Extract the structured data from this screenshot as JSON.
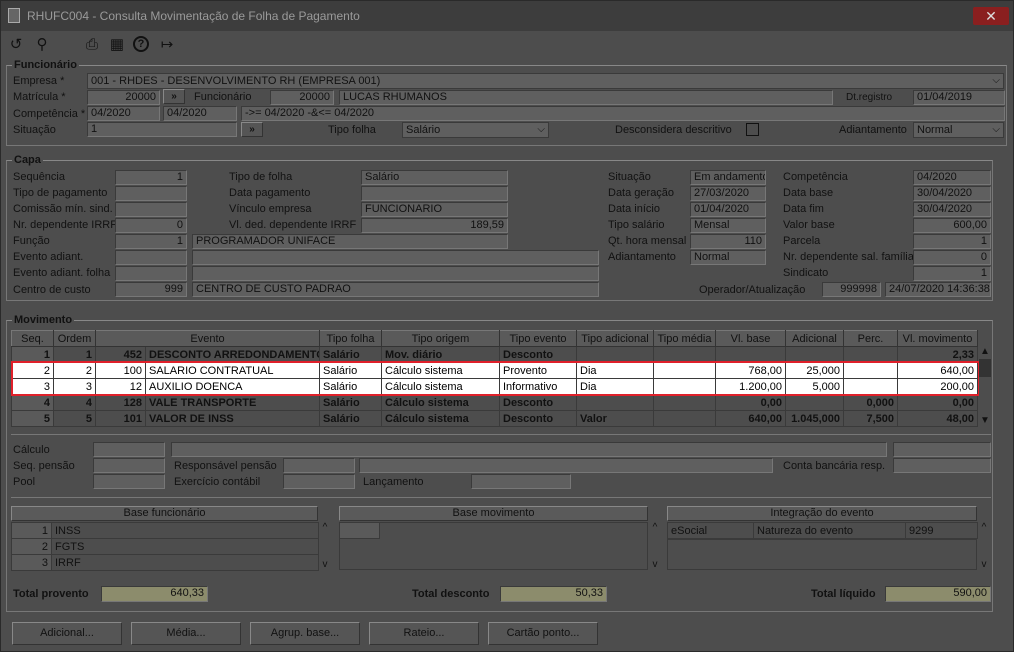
{
  "window": {
    "title": "RHUFC004 - Consulta Movimentação de Folha de Pagamento",
    "close": "✕"
  },
  "toolbar": {
    "icons": [
      "refresh-icon",
      "search-icon",
      "print-icon",
      "calendar-icon",
      "help-icon",
      "exit-icon"
    ],
    "glyphs": [
      "↺",
      "⚲",
      "⎙",
      "▦",
      "?",
      "↦"
    ]
  },
  "funcionario": {
    "title": "Funcionário",
    "empresa_label": "Empresa *",
    "empresa_value": "001 - RHDES - DESENVOLVIMENTO RH (EMPRESA 001)",
    "matricula_label": "Matrícula *",
    "matricula_value": "20000",
    "matricula_btn": "»",
    "funcionario_label": "Funcionário",
    "funcionario_code": "20000",
    "funcionario_name": "LUCAS RHUMANOS",
    "dtregistro_label": "Dt.registro",
    "dtregistro_value": "01/04/2019",
    "competencia_label": "Competência *",
    "competencia_de": "04/2020",
    "competencia_ate": "04/2020",
    "competencia_expr": "->= 04/2020 -&<= 04/2020",
    "situacao_label": "Situação",
    "situacao_value": "1",
    "situacao_btn": "»",
    "tipofolha_label": "Tipo folha",
    "tipofolha_value": "Salário",
    "descdesc_label": "Desconsidera descritivo",
    "adiantamento_label": "Adiantamento",
    "adiantamento_value": "Normal"
  },
  "capa": {
    "title": "Capa",
    "sequencia_label": "Sequência",
    "sequencia_value": "1",
    "tipopag_label": "Tipo de pagamento",
    "tipopag_value": "",
    "comissao_label": "Comissão mín. sind.",
    "comissao_value": "",
    "nrdep_label": "Nr. dependente IRRF",
    "nrdep_value": "0",
    "funcao_label": "Função",
    "funcao_code": "1",
    "funcao_name": "PROGRAMADOR UNIFACE",
    "evadiant_label": "Evento adiant.",
    "evadiant_value": "",
    "evadiantfolha_label": "Evento adiant. folha",
    "evadiantfolha_value": "",
    "ccusto_label": "Centro de custo",
    "ccusto_code": "999",
    "ccusto_name": "CENTRO DE CUSTO PADRAO",
    "tipofolha_label": "Tipo de folha",
    "tipofolha_value": "Salário",
    "datapag_label": "Data pagamento",
    "datapag_value": "",
    "vinculo_label": "Vínculo empresa",
    "vinculo_value": "FUNCIONARIO",
    "vlded_label": "Vl. ded. dependente IRRF",
    "vlded_value": "189,59",
    "situacao_label": "Situação",
    "situacao_value": "Em andamento",
    "datager_label": "Data geração",
    "datager_value": "27/03/2020",
    "dataini_label": "Data início",
    "dataini_value": "01/04/2020",
    "tiposal_label": "Tipo salário",
    "tiposal_value": "Mensal",
    "qthora_label": "Qt. hora mensal",
    "qthora_value": "110",
    "adiant_label": "Adiantamento",
    "adiant_value": "Normal",
    "comp_label": "Competência",
    "comp_value": "04/2020",
    "database_label": "Data base",
    "database_value": "30/04/2020",
    "datafim_label": "Data fim",
    "datafim_value": "30/04/2020",
    "valorbase_label": "Valor base",
    "valorbase_value": "600,00",
    "parcela_label": "Parcela",
    "parcela_value": "1",
    "nrdepsal_label": "Nr. dependente sal. família",
    "nrdepsal_value": "0",
    "sindicato_label": "Sindicato",
    "sindicato_value": "1",
    "operador_label": "Operador/Atualização",
    "operador_value": "999998",
    "operador_date": "24/07/2020 14:36:38"
  },
  "movimento": {
    "title": "Movimento",
    "columns": [
      "Seq.",
      "Ordem",
      "Evento",
      "",
      "Tipo folha",
      "Tipo origem",
      "Tipo evento",
      "Tipo adicional",
      "Tipo média",
      "Vl. base",
      "Adicional",
      "Perc.",
      "Vl. movimento"
    ],
    "rows": [
      {
        "seq": "1",
        "ordem": "1",
        "code": "452",
        "evento": "DESCONTO ARREDONDAMENTO SAL",
        "tipofolha": "Salário",
        "origem": "Mov. diário",
        "tipoevento": "Desconto",
        "adicional_t": "",
        "media": "",
        "vlbase": "",
        "adicional": "",
        "perc": "",
        "vlmov": "2,33",
        "style": "bold"
      },
      {
        "seq": "2",
        "ordem": "2",
        "code": "100",
        "evento": "SALARIO CONTRATUAL",
        "tipofolha": "Salário",
        "origem": "Cálculo sistema",
        "tipoevento": "Provento",
        "adicional_t": "Dia",
        "media": "",
        "vlbase": "768,00",
        "adicional": "25,000",
        "perc": "",
        "vlmov": "640,00",
        "style": "hl"
      },
      {
        "seq": "3",
        "ordem": "3",
        "code": "12",
        "evento": "AUXILIO DOENCA",
        "tipofolha": "Salário",
        "origem": "Cálculo sistema",
        "tipoevento": "Informativo",
        "adicional_t": "Dia",
        "media": "",
        "vlbase": "1.200,00",
        "adicional": "5,000",
        "perc": "",
        "vlmov": "200,00",
        "style": "hl"
      },
      {
        "seq": "4",
        "ordem": "4",
        "code": "128",
        "evento": "VALE TRANSPORTE",
        "tipofolha": "Salário",
        "origem": "Cálculo sistema",
        "tipoevento": "Desconto",
        "adicional_t": "",
        "media": "",
        "vlbase": "0,00",
        "adicional": "",
        "perc": "0,000",
        "vlmov": "0,00",
        "style": "bold"
      },
      {
        "seq": "5",
        "ordem": "5",
        "code": "101",
        "evento": "VALOR DE INSS",
        "tipofolha": "Salário",
        "origem": "Cálculo sistema",
        "tipoevento": "Desconto",
        "adicional_t": "Valor",
        "media": "",
        "vlbase": "640,00",
        "adicional": "1.045,000",
        "perc": "7,500",
        "vlmov": "48,00",
        "style": "bold"
      }
    ],
    "calculo_label": "Cálculo",
    "seqpensao_label": "Seq. pensão",
    "responsavel_label": "Responsável pensão",
    "conta_label": "Conta bancária resp.",
    "pool_label": "Pool",
    "exercicio_label": "Exercício contábil",
    "lancamento_label": "Lançamento"
  },
  "bases": {
    "funcionario_title": "Base funcionário",
    "funcionario_rows": [
      {
        "n": "1",
        "name": "INSS"
      },
      {
        "n": "2",
        "name": "FGTS"
      },
      {
        "n": "3",
        "name": "IRRF"
      }
    ],
    "movimento_title": "Base movimento",
    "integracao_title": "Integração do evento",
    "integracao_row": {
      "a": "eSocial",
      "b": "Natureza do evento",
      "c": "9299"
    }
  },
  "totais": {
    "provento_label": "Total provento",
    "provento_value": "640,33",
    "desconto_label": "Total desconto",
    "desconto_value": "50,33",
    "liquido_label": "Total líquido",
    "liquido_value": "590,00"
  },
  "buttons": [
    "Adicional...",
    "Média...",
    "Agrup. base...",
    "Rateio...",
    "Cartão ponto..."
  ]
}
